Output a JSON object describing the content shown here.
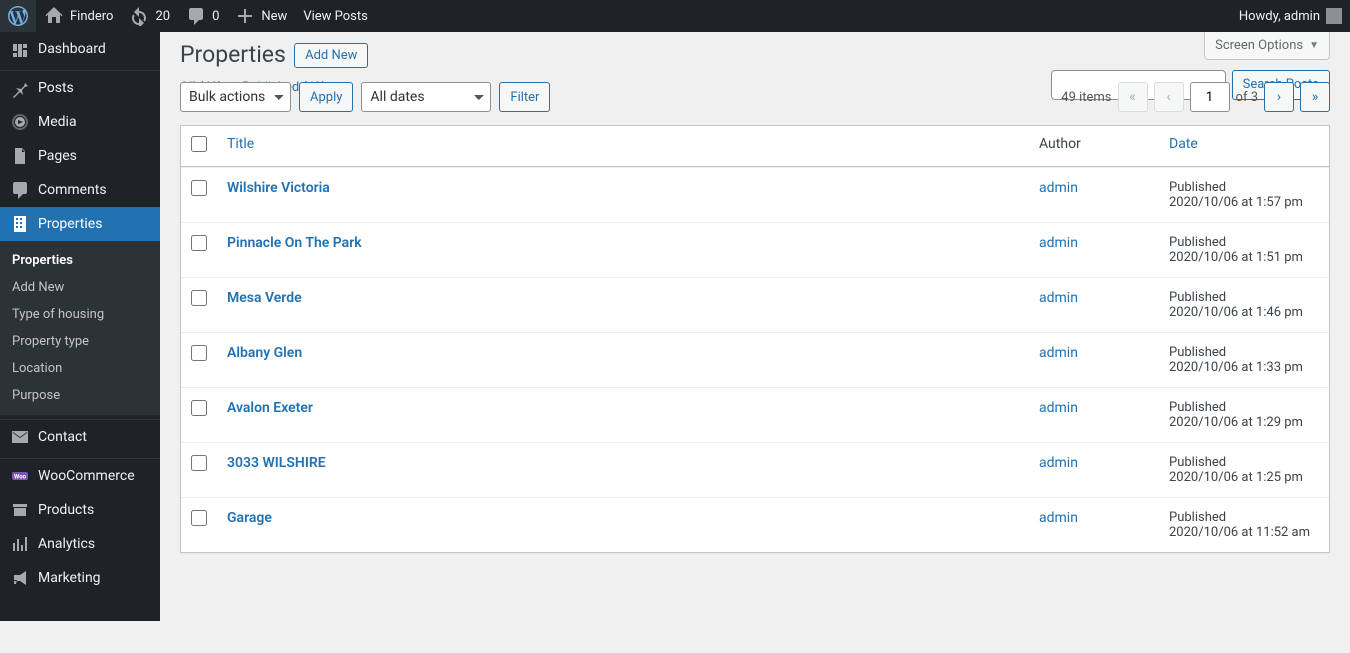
{
  "adminbar": {
    "site_name": "Findero",
    "updates": "20",
    "comments": "0",
    "new_label": "New",
    "view_posts": "View Posts",
    "howdy": "Howdy, admin"
  },
  "menu": {
    "dashboard": "Dashboard",
    "posts": "Posts",
    "media": "Media",
    "pages": "Pages",
    "comments": "Comments",
    "properties": "Properties",
    "contact": "Contact",
    "woocommerce": "WooCommerce",
    "products": "Products",
    "analytics": "Analytics",
    "marketing": "Marketing",
    "submenu": {
      "properties": "Properties",
      "add_new": "Add New",
      "type_housing": "Type of housing",
      "property_type": "Property type",
      "location": "Location",
      "purpose": "Purpose"
    }
  },
  "screen_options": "Screen Options",
  "heading": "Properties",
  "add_new_btn": "Add New",
  "views": {
    "all_label": "All",
    "all_count": "(49)",
    "published_label": "Published",
    "published_count": "(49)"
  },
  "search_btn": "Search Posts",
  "bulk_actions": "Bulk actions",
  "apply": "Apply",
  "all_dates": "All dates",
  "filter": "Filter",
  "items_count": "49 items",
  "current_page": "1",
  "pages_label": "of 3",
  "columns": {
    "title": "Title",
    "author": "Author",
    "date": "Date"
  },
  "rows": [
    {
      "title": "Wilshire Victoria",
      "author": "admin",
      "status": "Published",
      "date": "2020/10/06 at 1:57 pm"
    },
    {
      "title": "Pinnacle On The Park",
      "author": "admin",
      "status": "Published",
      "date": "2020/10/06 at 1:51 pm"
    },
    {
      "title": "Mesa Verde",
      "author": "admin",
      "status": "Published",
      "date": "2020/10/06 at 1:46 pm"
    },
    {
      "title": "Albany Glen",
      "author": "admin",
      "status": "Published",
      "date": "2020/10/06 at 1:33 pm"
    },
    {
      "title": "Avalon Exeter",
      "author": "admin",
      "status": "Published",
      "date": "2020/10/06 at 1:29 pm"
    },
    {
      "title": "3033 WILSHIRE",
      "author": "admin",
      "status": "Published",
      "date": "2020/10/06 at 1:25 pm"
    },
    {
      "title": "Garage",
      "author": "admin",
      "status": "Published",
      "date": "2020/10/06 at 11:52 am"
    }
  ]
}
